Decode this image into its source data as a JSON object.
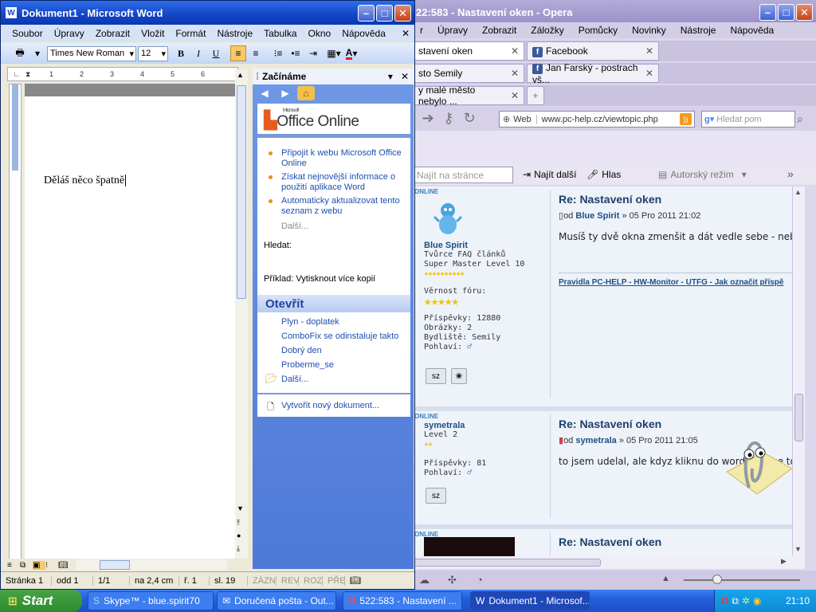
{
  "opera": {
    "title": "522:583 - Nastavení oken - Opera",
    "title_visible": "22:583 - Nastavení oken - Opera",
    "menu": [
      "r",
      "Úpravy",
      "Zobrazit",
      "Záložky",
      "Pomůcky",
      "Novinky",
      "Nástroje",
      "Nápověda"
    ],
    "tabs_row1": [
      {
        "label": "stavení oken",
        "active": true
      },
      {
        "label": "Facebook",
        "favicon": "facebook-icon"
      }
    ],
    "tabs_row2": [
      {
        "label": "sto Semily"
      },
      {
        "label": "Jan Farský - postrach vš...",
        "favicon": "facebook-icon"
      }
    ],
    "tabs_row3": [
      {
        "label": "y malé město nebylo ..."
      }
    ],
    "address": {
      "web_label": "Web",
      "url": "www.pc-help.cz/viewtopic.php",
      "search_placeholder": "Hledat pom"
    },
    "findbar": {
      "placeholder": "Najít na stránce",
      "find_next": "Najít další",
      "voice": "Hlas",
      "author_mode": "Autorský režim"
    },
    "posts": [
      {
        "status": "ONLINE",
        "author": "Blue Spirit",
        "rank1": "Tvůrce FAQ článků",
        "rank2": "Super Master Level 10",
        "loyalty_label": "Věrnost fóru:",
        "posts_label": "Příspěvky: 12880",
        "images_label": "Obrázky: 2",
        "residence_label": "Bydliště: Semily",
        "gender_label": "Pohlaví:",
        "pm_label": "sz",
        "title": "Re: Nastavení oken",
        "meta_from": "od",
        "meta_author": "Blue Spirit",
        "meta_date": "» 05 Pro 2011 21:02",
        "body": "Musíš ty dvě okna zmenšit a dát vedle sebe - nebo",
        "signature": [
          "Pravidla PC-HELP",
          "HW-Monitor",
          "UTFG",
          "Jak označit příspě"
        ]
      },
      {
        "status": "ONLINE",
        "author": "symetrala",
        "rank1": "Level 2",
        "posts_label": "Příspěvky: 81",
        "gender_label": "Pohlaví:",
        "pm_label": "sz",
        "title": "Re: Nastavení oken",
        "meta_from": "od",
        "meta_author": "symetrala",
        "meta_date": "» 05 Pro 2011 21:05",
        "body": "to jsem udelal, ale kdyz kliknu do wordu tak se to"
      },
      {
        "status": "ONLINE",
        "title": "Re: Nastavení oken"
      }
    ]
  },
  "word": {
    "title": "Dokument1 - Microsoft Word",
    "menu": [
      "Soubor",
      "Úpravy",
      "Zobrazit",
      "Vložit",
      "Formát",
      "Nástroje",
      "Tabulka",
      "Okno",
      "Nápověda"
    ],
    "font": "Times New Roman",
    "size": "12",
    "bold": "B",
    "italic": "I",
    "underline": "U",
    "font_color_glyph": "A",
    "ruler_numbers": [
      "1",
      "2",
      "3",
      "4",
      "5",
      "6"
    ],
    "document_text": "Děláš něco špatně",
    "status": {
      "page": "Stránka 1",
      "section": "odd 1",
      "pages": "1/1",
      "at": "na 2,4 cm",
      "line": "ř. 1",
      "col": "sl. 19",
      "rec": "ZÁZN",
      "rev": "REV",
      "ext": "ROZ",
      "ovr": "PŘE"
    }
  },
  "taskpane": {
    "title": "Začínáme",
    "logo_ms": "Microsoft",
    "logo": "Office Online",
    "links": [
      "Připojit k webu Microsoft Office Online",
      "Získat nejnovější informace o použití aplikace Word",
      "Automaticky aktualizovat tento seznam z webu"
    ],
    "more": "Další...",
    "search_label": "Hledat:",
    "example": "Příklad:  Vytisknout více kopií",
    "open_title": "Otevřít",
    "recent": [
      "Plyn - doplatek",
      "ComboFix se odinstaluje takto",
      "Dobrý den",
      "Proberme_se"
    ],
    "open_more": "Další...",
    "new_doc": "Vytvořit nový dokument..."
  },
  "taskbar": {
    "start": "Start",
    "buttons": [
      {
        "label": "Skype™ - blue.spirit70"
      },
      {
        "label": "Doručená pošta - Out..."
      },
      {
        "label": "522:583 - Nastavení ..."
      },
      {
        "label": "Dokument1 - Microsof..."
      }
    ],
    "clock": "21:10"
  },
  "colors": {
    "xp_blue": "#245edb",
    "opera_purple": "#9a90c9",
    "facebook": "#3b5998",
    "link_blue": "#1d4f82"
  }
}
